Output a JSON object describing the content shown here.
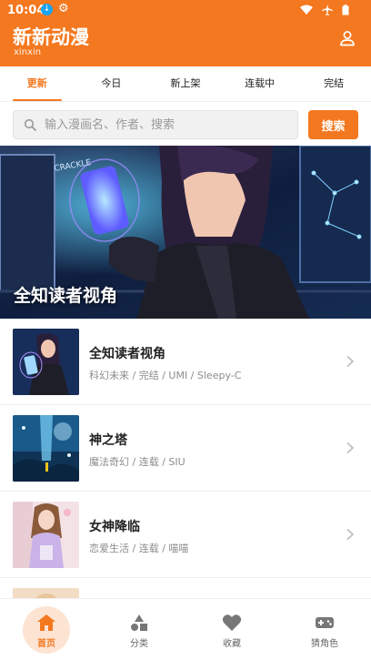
{
  "status_bar": {
    "time": "10:04"
  },
  "app": {
    "title": "新新动漫",
    "subtitle": "xinxin"
  },
  "tabs": [
    {
      "label": "更新",
      "active": true
    },
    {
      "label": "今日",
      "active": false
    },
    {
      "label": "新上架",
      "active": false
    },
    {
      "label": "连载中",
      "active": false
    },
    {
      "label": "完结",
      "active": false
    }
  ],
  "search": {
    "placeholder": "输入漫画名、作者、搜索",
    "button_label": "搜索"
  },
  "banner": {
    "title": "全知读者视角"
  },
  "comics": [
    {
      "title": "全知读者视角",
      "meta": "科幻未来 / 完结 / UMI / Sleepy-C"
    },
    {
      "title": "神之塔",
      "meta": "魔法奇幻 / 连载 / SIU"
    },
    {
      "title": "女神降临",
      "meta": "恋爱生活 / 连载 / 喵喵"
    }
  ],
  "bottom_nav": [
    {
      "label": "首页",
      "icon": "home-icon",
      "active": true
    },
    {
      "label": "分类",
      "icon": "category-icon",
      "active": false
    },
    {
      "label": "收藏",
      "icon": "heart-icon",
      "active": false
    },
    {
      "label": "猜角色",
      "icon": "gamepad-icon",
      "active": false
    }
  ],
  "colors": {
    "accent": "#f4781f",
    "accent_light": "#fde3d2"
  }
}
